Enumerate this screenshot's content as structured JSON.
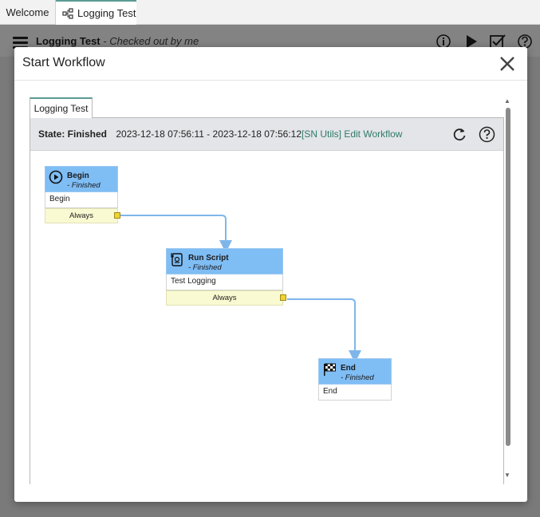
{
  "tabs": [
    {
      "label": "Welcome"
    },
    {
      "label": "Logging Test"
    }
  ],
  "app_header": {
    "title": "Logging Test",
    "subtitle": "- Checked out by me"
  },
  "modal": {
    "title": "Start Workflow",
    "inner_tab": "Logging Test",
    "state_label": "State: Finished",
    "timestamps": "2023-12-18 07:56:11 - 2023-12-18 07:56:12",
    "link_text": "[SN Utils] Edit Workflow"
  },
  "workflow": {
    "nodes": [
      {
        "name": "Begin",
        "status": "- Finished",
        "body": "Begin",
        "condition": "Always",
        "icon": "play-icon"
      },
      {
        "name": "Run Script",
        "status": "- Finished",
        "body": "Test Logging",
        "condition": "Always",
        "icon": "script-icon"
      },
      {
        "name": "End",
        "status": "- Finished",
        "body": "End",
        "icon": "checkered-flag-icon"
      }
    ]
  },
  "colors": {
    "node_header": "#7fbdf5",
    "condition_bg": "#fafad2",
    "connector": "#7fb6ea",
    "accent": "#5b9b94",
    "link": "#2e7b69"
  }
}
